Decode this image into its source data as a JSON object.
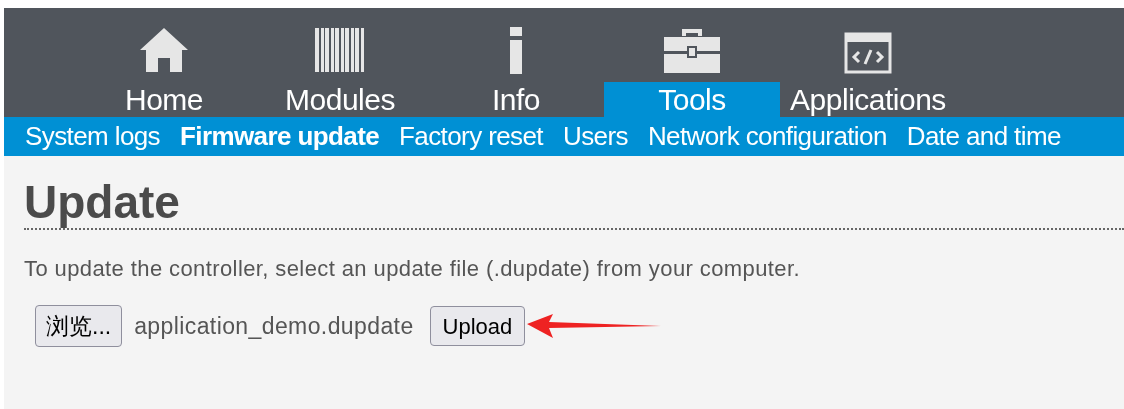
{
  "nav": [
    {
      "label": "Home",
      "selected": false
    },
    {
      "label": "Modules",
      "selected": false
    },
    {
      "label": "Info",
      "selected": false
    },
    {
      "label": "Tools",
      "selected": true
    },
    {
      "label": "Applications",
      "selected": false
    }
  ],
  "subnav": [
    {
      "label": "System logs",
      "selected": false
    },
    {
      "label": "Firmware update",
      "selected": true
    },
    {
      "label": "Factory reset",
      "selected": false
    },
    {
      "label": "Users",
      "selected": false
    },
    {
      "label": "Network configuration",
      "selected": false
    },
    {
      "label": "Date and time",
      "selected": false
    }
  ],
  "heading": "Update",
  "description": "To update the controller, select an update file (.dupdate) from your computer.",
  "browse_button": "浏览...",
  "file_name": "application_demo.dupdate",
  "upload_button": "Upload"
}
